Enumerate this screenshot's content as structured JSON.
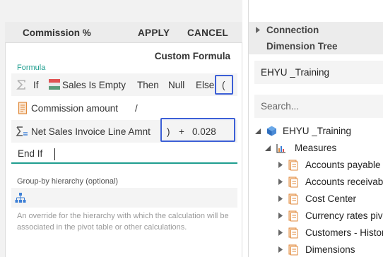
{
  "formula_editor": {
    "title": "Commission %",
    "apply_label": "APPLY",
    "cancel_label": "CANCEL",
    "subtitle": "Custom Formula",
    "formula_label": "Formula",
    "lines": {
      "line1": {
        "if": "If",
        "condition": "Sales Is Empty",
        "then": "Then",
        "null": "Null",
        "else": "Else",
        "open_paren": "("
      },
      "line2": {
        "measure": "Commission amount",
        "operator": "/"
      },
      "line3": {
        "measure": "Net Sales Invoice Line Amnt",
        "close_paren": ")",
        "plus": "+",
        "constant": "0.028"
      },
      "line4": {
        "end_if": "End If"
      }
    },
    "groupby_label": "Group-by hierarchy (optional)",
    "help_text": "An override for the hierarchy with which the calculation will be associated in the pivot table or other calculations."
  },
  "side_panel": {
    "connection_label": "Connection",
    "dimension_tree_label": "Dimension Tree",
    "selected_model": "EHYU _Training",
    "search_placeholder": "Search...",
    "tree": {
      "root": "EHYU _Training",
      "measures": "Measures",
      "items": [
        "Accounts payable",
        "Accounts receivable",
        "Cost Center",
        "Currency rates pivot",
        "Customers - History",
        "Dimensions"
      ]
    }
  },
  "colors": {
    "accent_teal": "#1f9e8f",
    "highlight_blue": "#3c5fd6",
    "header_bg": "#ececec"
  }
}
